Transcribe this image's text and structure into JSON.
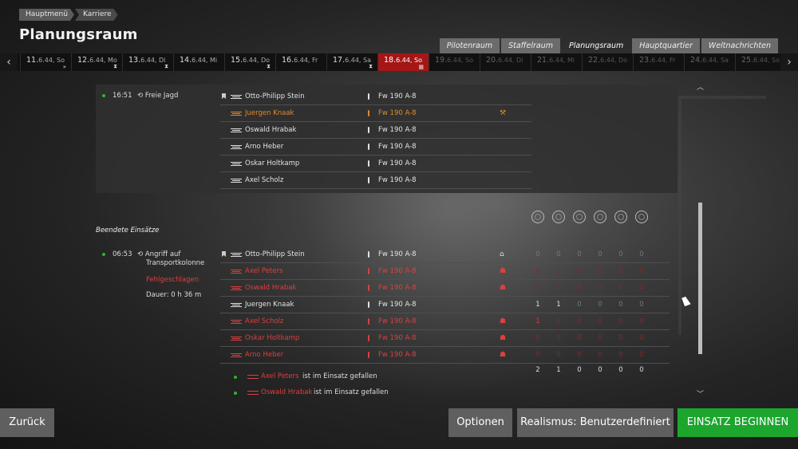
{
  "breadcrumb": [
    "Hauptmenü",
    "Karriere"
  ],
  "page_title": "Planungsraum",
  "tabs": [
    {
      "label": "Pilotenraum",
      "active": false
    },
    {
      "label": "Staffelraum",
      "active": false
    },
    {
      "label": "Planungsraum",
      "active": true
    },
    {
      "label": "Hauptquartier",
      "active": false
    },
    {
      "label": "Weltnachrichten",
      "active": false
    }
  ],
  "timeline": [
    {
      "num": "11.",
      "rest": "6.44, So",
      "state": "normal",
      "mark": "»"
    },
    {
      "num": "12.",
      "rest": "6.44, Mo",
      "state": "normal",
      "mark": "⧗"
    },
    {
      "num": "13.",
      "rest": "6.44, Di",
      "state": "normal",
      "mark": "⧗"
    },
    {
      "num": "14.",
      "rest": "6.44, Mi",
      "state": "normal",
      "mark": ""
    },
    {
      "num": "15.",
      "rest": "6.44, Do",
      "state": "normal",
      "mark": "⧗"
    },
    {
      "num": "16.",
      "rest": "6.44, Fr",
      "state": "normal",
      "mark": ""
    },
    {
      "num": "17.",
      "rest": "6.44, Sa",
      "state": "normal",
      "mark": "⧗"
    },
    {
      "num": "18.",
      "rest": "6.44, So",
      "state": "active",
      "mark": "▦"
    },
    {
      "num": "19.",
      "rest": "6.44, So",
      "state": "dim",
      "mark": ""
    },
    {
      "num": "20.",
      "rest": "6.44, Di",
      "state": "dim",
      "mark": ""
    },
    {
      "num": "21.",
      "rest": "6.44, Mi",
      "state": "dim",
      "mark": ""
    },
    {
      "num": "22.",
      "rest": "6.44, Do",
      "state": "dim",
      "mark": ""
    },
    {
      "num": "23.",
      "rest": "6.44, Fr",
      "state": "dim",
      "mark": ""
    },
    {
      "num": "24.",
      "rest": "6.44, Sa",
      "state": "dim",
      "mark": ""
    },
    {
      "num": "25.",
      "rest": "6.44, So",
      "state": "dim",
      "mark": ""
    }
  ],
  "planned": {
    "time": "16:51",
    "type": "Freie Jagd",
    "pilots": [
      {
        "name": "Otto-Philipp Stein",
        "plane": "Fw 190 A-8",
        "color": "white",
        "status": ""
      },
      {
        "name": "Juergen Knaak",
        "plane": "Fw 190 A-8",
        "color": "orange",
        "status": "⚒"
      },
      {
        "name": "Oswald Hrabak",
        "plane": "Fw 190 A-8",
        "color": "white",
        "status": ""
      },
      {
        "name": "Arno Heber",
        "plane": "Fw 190 A-8",
        "color": "white",
        "status": ""
      },
      {
        "name": "Oskar Holtkamp",
        "plane": "Fw 190 A-8",
        "color": "white",
        "status": ""
      },
      {
        "name": "Axel Scholz",
        "plane": "Fw 190 A-8",
        "color": "white",
        "status": ""
      }
    ]
  },
  "completed": {
    "section_label": "Beendete Einsätze",
    "time": "06:53",
    "type_line1": "Angriff auf",
    "type_line2": "Transportkolonne",
    "result": "Fehlgeschlagen",
    "duration": "Dauer: 0 h 36 m",
    "pilots": [
      {
        "name": "Otto-Philipp Stein",
        "plane": "Fw 190 A-8",
        "color": "white",
        "status": "⌂",
        "stats": [
          "0",
          "0",
          "0",
          "0",
          "0",
          "0"
        ]
      },
      {
        "name": "Axel Peters",
        "plane": "Fw 190 A-8",
        "color": "red",
        "status": "☗",
        "stats": [
          "0",
          "0",
          "0",
          "0",
          "0",
          "0"
        ]
      },
      {
        "name": "Oswald Hrabak",
        "plane": "Fw 190 A-8",
        "color": "red",
        "status": "☗",
        "stats": [
          "0",
          "0",
          "0",
          "0",
          "0",
          "0"
        ]
      },
      {
        "name": "Juergen Knaak",
        "plane": "Fw 190 A-8",
        "color": "white",
        "status": "",
        "stats": [
          "1",
          "1",
          "0",
          "0",
          "0",
          "0"
        ]
      },
      {
        "name": "Axel Scholz",
        "plane": "Fw 190 A-8",
        "color": "red",
        "status": "☗",
        "stats": [
          "1",
          "0",
          "0",
          "0",
          "0",
          "0"
        ]
      },
      {
        "name": "Oskar Holtkamp",
        "plane": "Fw 190 A-8",
        "color": "red",
        "status": "☗",
        "stats": [
          "0",
          "0",
          "0",
          "0",
          "0",
          "0"
        ]
      },
      {
        "name": "Arno Heber",
        "plane": "Fw 190 A-8",
        "color": "red",
        "status": "☗",
        "stats": [
          "0",
          "0",
          "0",
          "0",
          "0",
          "0"
        ]
      }
    ],
    "totals": [
      "2",
      "1",
      "0",
      "0",
      "0",
      "0"
    ],
    "notes": [
      {
        "name": "Axel Peters",
        "text": "ist im Einsatz gefallen"
      },
      {
        "name": "Oswald Hrabak",
        "text": "ist im Einsatz gefallen"
      }
    ]
  },
  "buttons": {
    "back": "Zurück",
    "options": "Optionen",
    "realism": "Realismus: Benutzerdefiniert",
    "start": "EINSATZ BEGINNEN"
  },
  "colors": {
    "active_day": "#a51616",
    "start_button": "#1ca62e",
    "killed": "#d9413f",
    "wounded": "#e08a2c"
  }
}
